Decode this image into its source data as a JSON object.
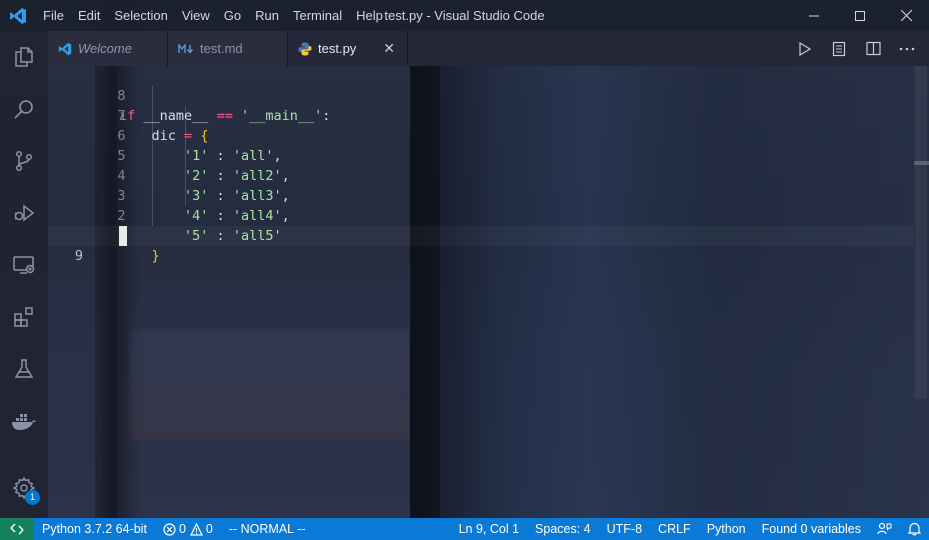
{
  "window": {
    "title": "test.py - Visual Studio Code",
    "menu": [
      "File",
      "Edit",
      "Selection",
      "View",
      "Go",
      "Run",
      "Terminal",
      "Help"
    ]
  },
  "activity_bar": {
    "items": [
      "explorer-icon",
      "search-icon",
      "source-control-icon",
      "run-debug-icon",
      "remote-explorer-icon",
      "extensions-icon",
      "testing-icon",
      "docker-icon"
    ],
    "settings_badge": "1"
  },
  "tabs": [
    {
      "label": "Welcome",
      "icon": "vscode-icon",
      "active": false
    },
    {
      "label": "test.md",
      "icon": "markdown-icon",
      "active": false
    },
    {
      "label": "test.py",
      "icon": "python-icon",
      "active": true
    }
  ],
  "tab_close": "✕",
  "editor": {
    "line_numbers": [
      "8",
      "7",
      "6",
      "5",
      "4",
      "3",
      "2",
      "1",
      "9"
    ],
    "code": {
      "l1": {
        "kw": "if",
        "name": "__name__",
        "op": "==",
        "q1": "'",
        "main": "__main__",
        "q2": "'",
        "colon": ":"
      },
      "l2": {
        "var": "dic",
        "eq": "=",
        "brace": "{"
      },
      "l3": {
        "key": "'1'",
        "sep": " : ",
        "val": "'all'",
        "comma": ","
      },
      "l4": {
        "key": "'2'",
        "sep": " : ",
        "val": "'all2'",
        "comma": ","
      },
      "l5": {
        "key": "'3'",
        "sep": " : ",
        "val": "'all3'",
        "comma": ","
      },
      "l6": {
        "key": "'4'",
        "sep": " : ",
        "val": "'all4'",
        "comma": ","
      },
      "l7": {
        "key": "'5'",
        "sep": " : ",
        "val": "'all5'"
      },
      "l8": {
        "brace": "}"
      }
    }
  },
  "status_bar": {
    "interpreter": "Python 3.7.2 64-bit",
    "errors": "0",
    "warnings": "0",
    "mode": "-- NORMAL --",
    "position": "Ln 9, Col 1",
    "spaces": "Spaces: 4",
    "encoding": "UTF-8",
    "eol": "CRLF",
    "language": "Python",
    "variables": "Found 0 variables"
  },
  "colors": {
    "status_bar": "#0b7ad6",
    "remote": "#16825d",
    "keyword": "#ff5c8a",
    "string": "#a6e3a1",
    "brace": "#f5c518"
  }
}
